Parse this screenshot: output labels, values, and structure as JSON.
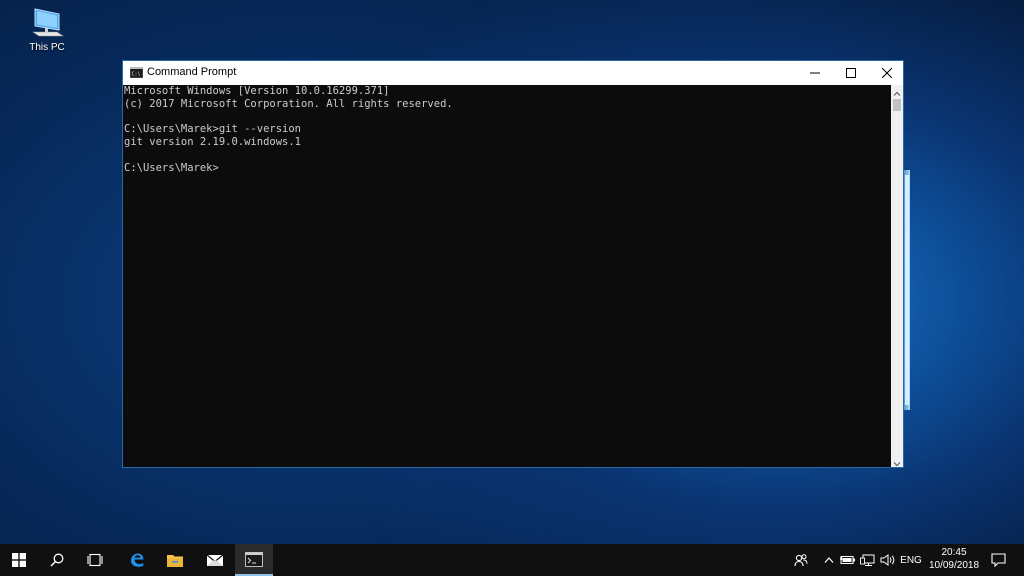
{
  "desktop": {
    "icons": [
      {
        "label": "This PC",
        "icon": "computer-icon"
      }
    ]
  },
  "window": {
    "title": "Command Prompt",
    "icon": "cmd-icon",
    "controls": [
      "minimize-icon",
      "maximize-icon",
      "close-icon"
    ],
    "console_lines": [
      "Microsoft Windows [Version 10.0.16299.371]",
      "(c) 2017 Microsoft Corporation. All rights reserved.",
      "",
      "C:\\Users\\Marek>git --version",
      "git version 2.19.0.windows.1",
      "",
      "C:\\Users\\Marek>"
    ]
  },
  "taskbar": {
    "buttons": [
      "start-icon",
      "search-icon",
      "task-view-icon",
      "edge-icon",
      "file-explorer-icon",
      "mail-icon",
      "cmd-icon"
    ],
    "tray": {
      "icons": [
        "people-icon",
        "chevron-up-icon",
        "battery-icon",
        "network-icon",
        "volume-icon"
      ],
      "language": "ENG",
      "time": "20:45",
      "date": "10/09/2018",
      "notification_icon": "action-center-icon"
    }
  },
  "colors": {
    "console_bg": "#0c0c0c",
    "console_text": "#cccccc",
    "taskbar_bg": "#101010",
    "window_border": "#2a67a8",
    "accent": "#8fc1ea"
  }
}
